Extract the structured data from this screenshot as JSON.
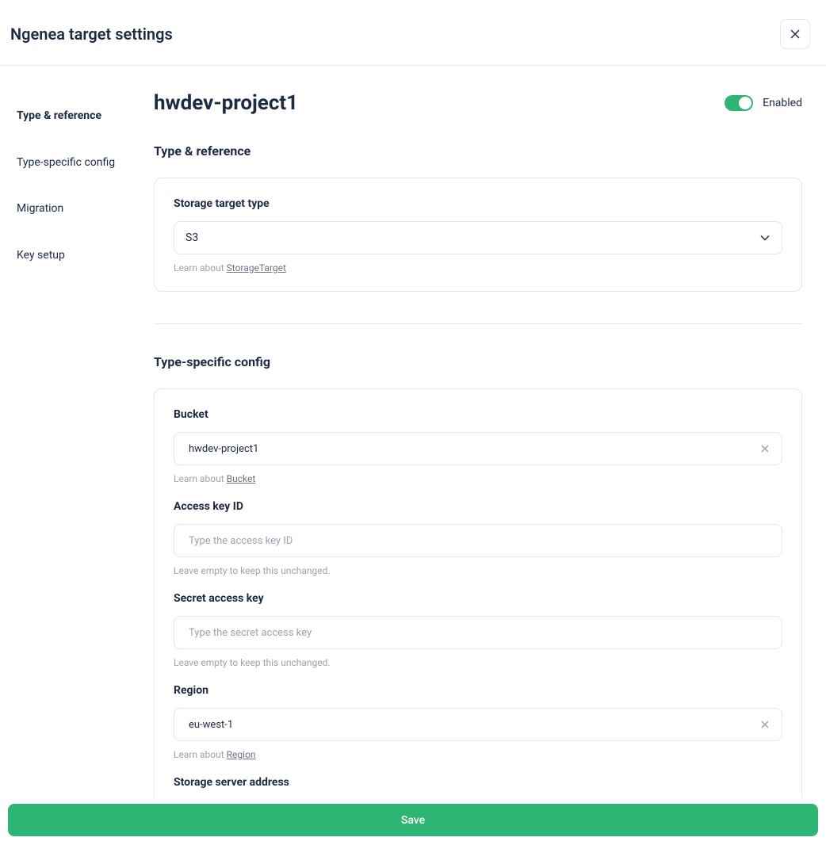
{
  "header": {
    "title": "Ngenea target settings"
  },
  "sidebar": {
    "items": [
      {
        "label": "Type & reference",
        "active": true
      },
      {
        "label": "Type-specific config",
        "active": false
      },
      {
        "label": "Migration",
        "active": false
      },
      {
        "label": "Key setup",
        "active": false
      }
    ]
  },
  "page": {
    "title": "hwdev-project1",
    "enabled_label": "Enabled"
  },
  "sections": {
    "type_reference": {
      "heading": "Type & reference",
      "storage_type_label": "Storage target type",
      "storage_type_value": "S3",
      "learn_prefix": "Learn about ",
      "learn_link": "StorageTarget"
    },
    "type_specific": {
      "heading": "Type-specific config",
      "bucket": {
        "label": "Bucket",
        "value": "hwdev-project1",
        "learn_prefix": "Learn about ",
        "learn_link": "Bucket"
      },
      "access_key": {
        "label": "Access key ID",
        "placeholder": "Type the access key ID",
        "help": "Leave empty to keep this unchanged."
      },
      "secret_key": {
        "label": "Secret access key",
        "placeholder": "Type the secret access key",
        "help": "Leave empty to keep this unchanged."
      },
      "region": {
        "label": "Region",
        "value": "eu-west-1",
        "learn_prefix": "Learn about ",
        "learn_link": "Region"
      },
      "server_address": {
        "label": "Storage server address"
      }
    }
  },
  "footer": {
    "save_label": "Save"
  }
}
